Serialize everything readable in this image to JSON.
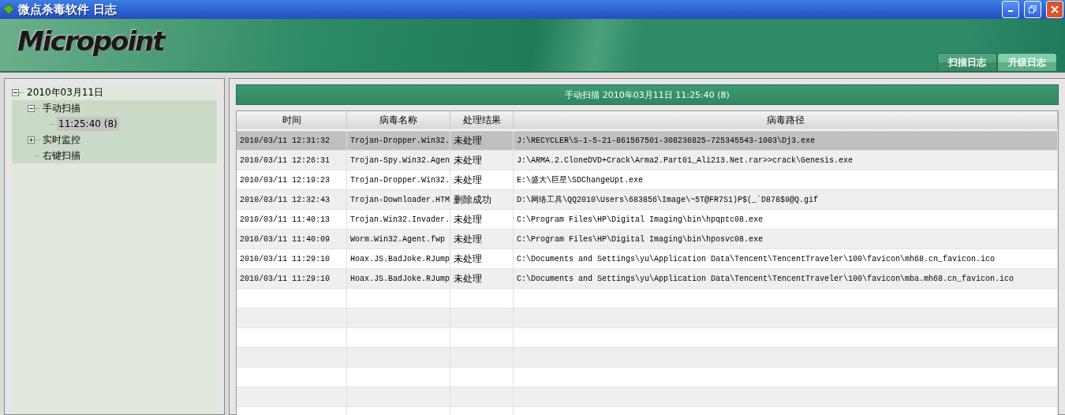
{
  "window": {
    "title": "微点杀毒软件 日志"
  },
  "logo": {
    "text": "Micropoint"
  },
  "tabs": [
    {
      "label": "扫描日志",
      "selected": true
    },
    {
      "label": "升级日志",
      "selected": false
    }
  ],
  "tree": [
    {
      "label": "2010年03月11日",
      "expanded": true,
      "selected": false,
      "children": [
        {
          "label": "手动扫描",
          "expanded": true,
          "selected": false,
          "children": [
            {
              "label": "11:25:40 (8)",
              "selected": true
            }
          ]
        },
        {
          "label": "实时监控",
          "expanded": false,
          "selected": false
        },
        {
          "label": "右键扫描",
          "selected": false
        }
      ]
    }
  ],
  "banner": "手动扫描 2010年03月11日 11:25:40 (8)",
  "table": {
    "columns": [
      "时间",
      "病毒名称",
      "处理结果",
      "病毒路径"
    ],
    "rows": [
      {
        "selected": true,
        "cells": [
          "2010/03/11 12:31:32",
          "Trojan-Dropper.Win32.",
          "未处理",
          "J:\\RECYCLER\\S-1-5-21-861567501-308236825-725345543-1003\\Dj3.exe"
        ]
      },
      {
        "selected": false,
        "cells": [
          "2010/03/11 12:26:31",
          "Trojan-Spy.Win32.Agen",
          "未处理",
          "J:\\ARMA.2.CloneDVD+Crack\\Arma2.Part01_Ali213.Net.rar>>crack\\Genesis.exe"
        ]
      },
      {
        "selected": false,
        "cells": [
          "2010/03/11 12:19:23",
          "Trojan-Dropper.Win32.",
          "未处理",
          "E:\\盛大\\巨星\\SDChangeUpt.exe"
        ]
      },
      {
        "selected": false,
        "cells": [
          "2010/03/11 12:32:43",
          "Trojan-Downloader.HTM",
          "删除成功",
          "D:\\网络工具\\QQ2010\\Users\\683856\\Image\\~5T@FR7S1)P$(_`D878$9@Q.gif"
        ]
      },
      {
        "selected": false,
        "cells": [
          "2010/03/11 11:40:13",
          "Trojan.Win32.Invader.",
          "未处理",
          "C:\\Program Files\\HP\\Digital Imaging\\bin\\hpqptc08.exe"
        ]
      },
      {
        "selected": false,
        "cells": [
          "2010/03/11 11:40:09",
          "Worm.Win32.Agent.fwp",
          "未处理",
          "C:\\Program Files\\HP\\Digital Imaging\\bin\\hposvc08.exe"
        ]
      },
      {
        "selected": false,
        "cells": [
          "2010/03/11 11:29:10",
          "Hoax.JS.BadJoke.RJump",
          "未处理",
          "C:\\Documents and Settings\\yu\\Application Data\\Tencent\\TencentTraveler\\100\\favicon\\mh68.cn_favicon.ico"
        ]
      },
      {
        "selected": false,
        "cells": [
          "2010/03/11 11:29:10",
          "Hoax.JS.BadJoke.RJump",
          "未处理",
          "C:\\Documents and Settings\\yu\\Application Data\\Tencent\\TencentTraveler\\100\\favicon\\mba.mh68.cn_favicon.ico"
        ]
      }
    ]
  }
}
